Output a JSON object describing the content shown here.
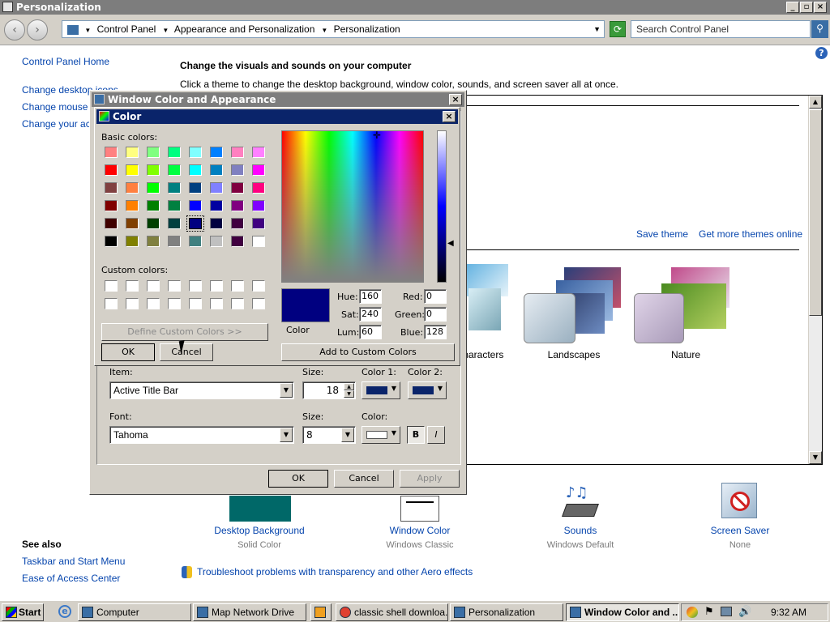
{
  "window": {
    "title": "Personalization"
  },
  "address": {
    "crumbs": [
      "Control Panel",
      "Appearance and Personalization",
      "Personalization"
    ],
    "search_placeholder": "Search Control Panel"
  },
  "left_nav": {
    "home": "Control Panel Home",
    "links": [
      "Change desktop icons",
      "Change mouse pointers",
      "Change your account picture"
    ],
    "see_also_title": "See also",
    "see_also": [
      "Taskbar and Start Menu",
      "Ease of Access Center"
    ]
  },
  "main": {
    "heading": "Change the visuals and sounds on your computer",
    "subheading": "Click a theme to change the desktop background, window color, sounds, and screen saver all at once.",
    "save_theme": "Save theme",
    "get_more": "Get more themes online",
    "themes": [
      "Characters",
      "Landscapes",
      "Nature"
    ],
    "bottom": [
      {
        "label": "Desktop Background",
        "sub": "Solid Color"
      },
      {
        "label": "Window Color",
        "sub": "Windows Classic"
      },
      {
        "label": "Sounds",
        "sub": "Windows Default"
      },
      {
        "label": "Screen Saver",
        "sub": "None"
      }
    ],
    "troubleshoot": "Troubleshoot problems with transparency and other Aero effects"
  },
  "wca": {
    "title": "Window Color and Appearance",
    "item_label": "Item:",
    "item_value": "Active Title Bar",
    "size_label": "Size:",
    "size_value": "18",
    "color1_label": "Color 1:",
    "color2_label": "Color 2:",
    "font_label": "Font:",
    "font_value": "Tahoma",
    "font_size_label": "Size:",
    "font_size_value": "8",
    "font_color_label": "Color:",
    "bold": "B",
    "italic": "I",
    "ok": "OK",
    "cancel": "Cancel",
    "apply": "Apply"
  },
  "color": {
    "title": "Color",
    "basic_label": "Basic colors:",
    "custom_label": "Custom colors:",
    "define": "Define Custom Colors >>",
    "ok": "OK",
    "cancel": "Cancel",
    "color_label": "Color",
    "hue_label": "Hue:",
    "hue": "160",
    "sat_label": "Sat:",
    "sat": "240",
    "lum_label": "Lum:",
    "lum": "60",
    "red_label": "Red:",
    "red": "0",
    "green_label": "Green:",
    "green": "0",
    "blue_label": "Blue:",
    "blue": "128",
    "add": "Add to Custom Colors",
    "selected": "#000080",
    "basic": [
      "#ff8080",
      "#ffff80",
      "#80ff80",
      "#00ff80",
      "#80ffff",
      "#0080ff",
      "#ff80c0",
      "#ff80ff",
      "#ff0000",
      "#ffff00",
      "#80ff00",
      "#00ff40",
      "#00ffff",
      "#0080c0",
      "#8080c0",
      "#ff00ff",
      "#804040",
      "#ff8040",
      "#00ff00",
      "#008080",
      "#004080",
      "#8080ff",
      "#800040",
      "#ff0080",
      "#800000",
      "#ff8000",
      "#008000",
      "#008040",
      "#0000ff",
      "#0000a0",
      "#800080",
      "#8000ff",
      "#400000",
      "#804000",
      "#004000",
      "#004040",
      "#000080",
      "#000040",
      "#400040",
      "#400080",
      "#000000",
      "#808000",
      "#808040",
      "#808080",
      "#408080",
      "#c0c0c0",
      "#400040",
      "#ffffff"
    ]
  },
  "taskbar": {
    "start": "Start",
    "tasks": [
      "Computer",
      "Map Network Drive",
      "",
      "classic shell downloa...",
      "Personalization",
      "Window Color and ..."
    ],
    "clock": "9:32 AM"
  }
}
